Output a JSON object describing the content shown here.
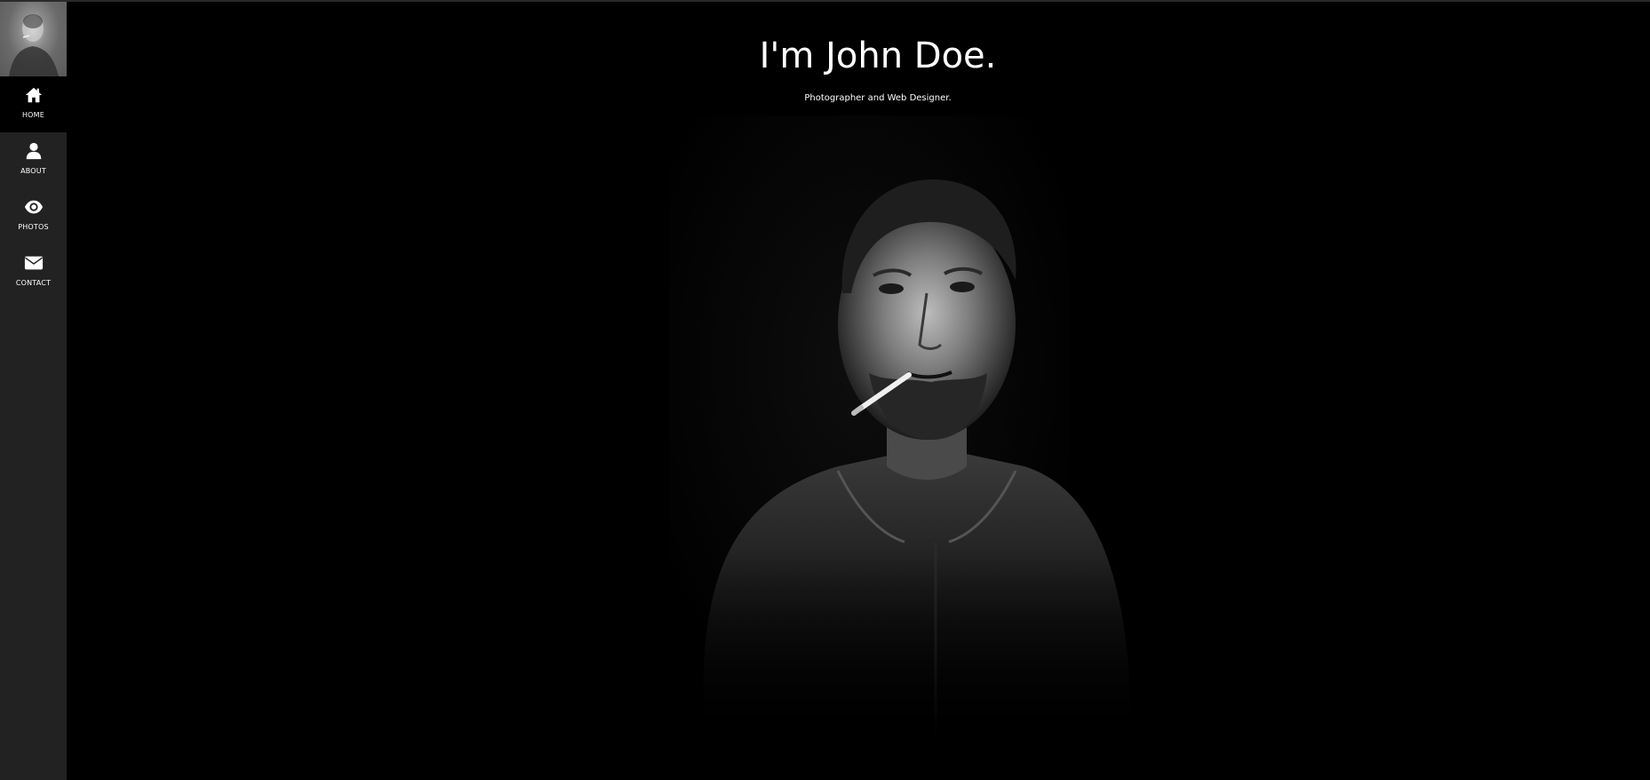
{
  "sidebar": {
    "avatar_icon": "avatar-photo",
    "items": [
      {
        "label": "HOME",
        "icon": "home-icon",
        "active": true
      },
      {
        "label": "ABOUT",
        "icon": "user-icon",
        "active": false
      },
      {
        "label": "PHOTOS",
        "icon": "eye-icon",
        "active": false
      },
      {
        "label": "CONTACT",
        "icon": "envelope-icon",
        "active": false
      }
    ]
  },
  "hero": {
    "title": "I'm John Doe.",
    "subtitle": "Photographer and Web Designer."
  },
  "colors": {
    "sidebar_bg": "#222222",
    "page_bg": "#000000",
    "text": "#ffffff"
  }
}
